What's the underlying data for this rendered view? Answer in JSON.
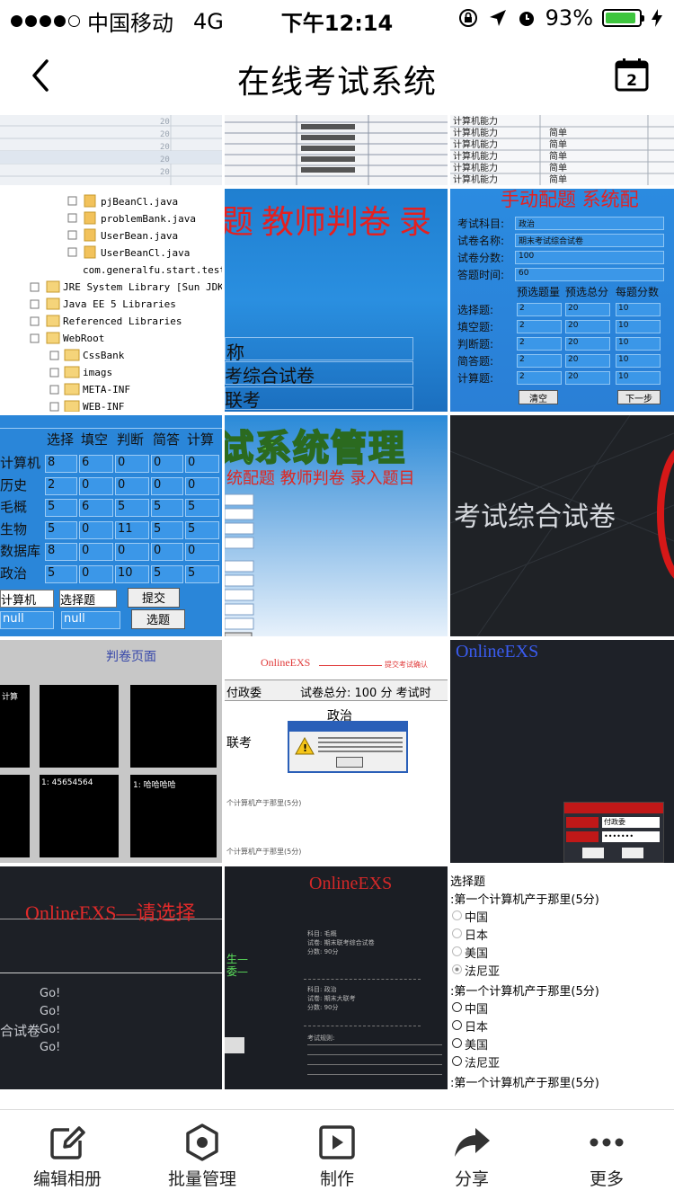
{
  "status": {
    "carrier": "中国移动",
    "network": "4G",
    "time": "下午12:14",
    "battery_pct": "93%",
    "battery_level": 0.93
  },
  "nav": {
    "title": "在线考试系统"
  },
  "tiles": {
    "t2": {
      "files": [
        "pjBeanCl.java",
        "problemBank.java",
        "UserBean.java",
        "UserBeanCl.java",
        "com.generalfu.start.test",
        "JRE System Library [Sun JDK",
        "Java EE 5 Libraries",
        "Referenced Libraries",
        "WebRoot",
        "CssBank",
        "imags",
        "META-INF",
        "WEB-INF"
      ]
    },
    "t3": {
      "heading": "题  教师判卷  录",
      "lines": [
        "称",
        "考综合试卷",
        "联考"
      ]
    },
    "t4": {
      "heading": "手动配题  系统配",
      "fields": [
        {
          "label": "考试科目:",
          "value": "政治"
        },
        {
          "label": "试卷名称:",
          "value": "期末考试综合试卷"
        },
        {
          "label": "试卷分数:",
          "value": "100"
        },
        {
          "label": "答题时间:",
          "value": "60"
        }
      ],
      "headers": [
        "预选题量",
        "预选总分",
        "每题分数"
      ],
      "rows": [
        {
          "label": "选择题:",
          "cells": [
            "2",
            "20",
            "10"
          ]
        },
        {
          "label": "填空题:",
          "cells": [
            "2",
            "20",
            "10"
          ]
        },
        {
          "label": "判断题:",
          "cells": [
            "2",
            "20",
            "10"
          ]
        },
        {
          "label": "简答题:",
          "cells": [
            "2",
            "20",
            "10"
          ]
        },
        {
          "label": "计算题:",
          "cells": [
            "2",
            "20",
            "10"
          ]
        }
      ],
      "btn_clear": "清空",
      "btn_next": "下一步"
    },
    "t5": {
      "headers": [
        "选择",
        "填空",
        "判断",
        "简答",
        "计算"
      ],
      "rows": [
        {
          "name": "计算机",
          "cells": [
            "8",
            "6",
            "0",
            "0",
            "0"
          ]
        },
        {
          "name": "历史",
          "cells": [
            "2",
            "0",
            "0",
            "0",
            "0"
          ]
        },
        {
          "name": "毛概",
          "cells": [
            "5",
            "6",
            "5",
            "5",
            "5"
          ]
        },
        {
          "name": "生物",
          "cells": [
            "5",
            "0",
            "11",
            "5",
            "5"
          ]
        },
        {
          "name": "数据库",
          "cells": [
            "8",
            "0",
            "0",
            "0",
            "0"
          ]
        },
        {
          "name": "政治",
          "cells": [
            "5",
            "0",
            "10",
            "5",
            "5"
          ]
        }
      ],
      "select1": "计算机",
      "select2": "选择题",
      "submit": "提交",
      "input1": "null",
      "input2": "null",
      "pick": "选题"
    },
    "t6": {
      "banner": "试系统管理",
      "menu": "统配题  教师判卷  录入题目"
    },
    "t7": {
      "text": "考试综合试卷"
    },
    "t8": {
      "title": "判卷页面",
      "sub1": "计算",
      "val1": "1: 45654564",
      "val2": "1: 哈哈哈哈"
    },
    "t9": {
      "logo": "OnlineEXS",
      "sub": "提交考试确认",
      "who": "付政委",
      "score": "试卷总分:  100  分  考试时",
      "subject": "政治",
      "lk": "联考",
      "q1": "个计算机产于那里(5分)",
      "q2": "个计算机产于那里(5分)"
    },
    "t10": {
      "logo": "OnlineEXS",
      "user": "付政委",
      "pass": "•••••••"
    },
    "t11": {
      "title": "OnlineEXS—请选择",
      "label": "合试卷",
      "go": [
        "Go!",
        "Go!",
        "Go!",
        "Go!"
      ]
    },
    "t12": {
      "title": "OnlineEXS",
      "side1": "生—",
      "side2": "委—",
      "info1": [
        "科目: 毛概",
        "试卷: 期末联考综合试卷",
        "分数: 90分"
      ],
      "info2": [
        "科目: 政治",
        "试卷: 期末大联考",
        "分数: 90分"
      ],
      "rules": "考试规则:"
    },
    "t13": {
      "type": "选择题",
      "q": ":第一个计算机产于那里(5分)",
      "options": [
        "中国",
        "日本",
        "美国",
        "法尼亚"
      ]
    }
  },
  "toolbar": {
    "items": [
      {
        "label": "编辑相册",
        "icon": "edit-icon"
      },
      {
        "label": "批量管理",
        "icon": "hexagon-icon"
      },
      {
        "label": "制作",
        "icon": "play-icon"
      },
      {
        "label": "分享",
        "icon": "share-icon"
      },
      {
        "label": "更多",
        "icon": "more-icon"
      }
    ]
  }
}
